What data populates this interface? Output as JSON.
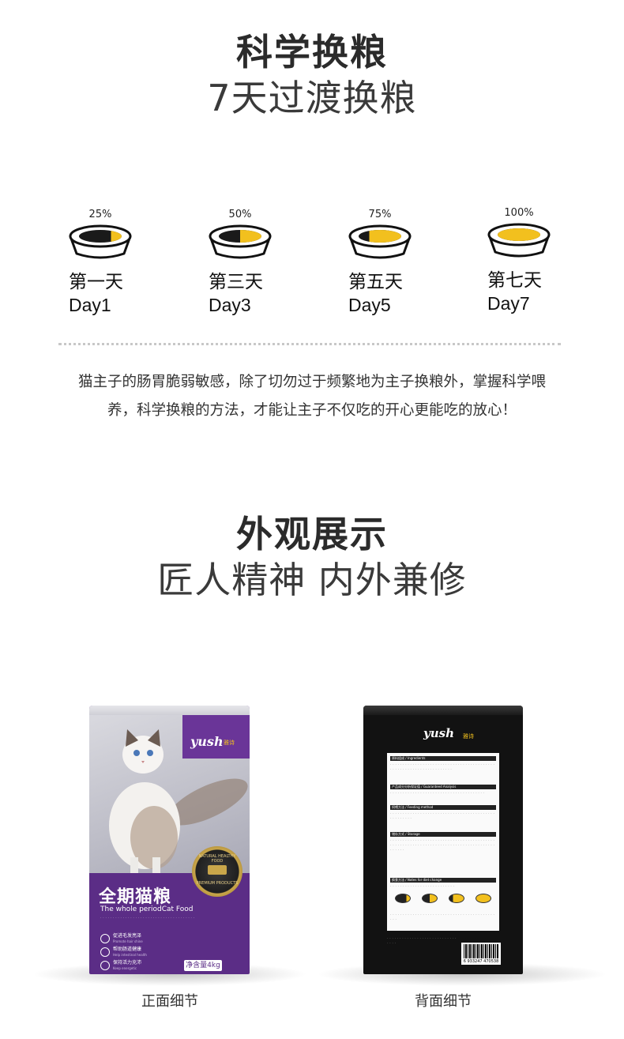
{
  "section1": {
    "title": "科学换粮",
    "subtitle": "7天过渡换粮",
    "steps": [
      {
        "percent": "25%",
        "fill": 0.25,
        "day_cn": "第一天",
        "day_en": "Day1"
      },
      {
        "percent": "50%",
        "fill": 0.5,
        "day_cn": "第三天",
        "day_en": "Day3"
      },
      {
        "percent": "75%",
        "fill": 0.75,
        "day_cn": "第五天",
        "day_en": "Day5"
      },
      {
        "percent": "100%",
        "fill": 1.0,
        "day_cn": "第七天",
        "day_en": "Day7"
      }
    ],
    "paragraph_line1": "猫主子的肠胃脆弱敏感，除了切勿过于频繁地为主子换粮外，掌握科学喂",
    "paragraph_line2": "养，科学换粮的方法，才能让主子不仅吃的开心更能吃的放心！"
  },
  "section2": {
    "title": "外观展示",
    "subtitle": "匠人精神 内外兼修"
  },
  "front_package": {
    "brand": "yush",
    "brand_cn": "雅诗",
    "product_name": "全期猫粮",
    "product_name_en": "The whole periodCat Food",
    "seal_top": "NATURAL HEALTHY FOOD",
    "seal_bottom": "PREMIUM PRODUCTS",
    "features": [
      "促进毛发亮泽",
      "帮助肠道健康",
      "保持活力充沛"
    ],
    "features_en": [
      "Promote hair shine",
      "Help intestinal health",
      "Keep energetic"
    ],
    "net_weight": "净含量4kg",
    "caption": "正面细节"
  },
  "back_package": {
    "brand": "yush",
    "brand_cn": "雅诗",
    "sections": [
      "原料组成 / Ingredients",
      "产品成分分析保证值 / Guaranteed Analysis",
      "饲喂方法 / Feeding method",
      "储存方式 / Storage",
      "换食方法 / Notes for diet change"
    ],
    "barcode_number": "6 933247 470538",
    "caption": "背面细节"
  },
  "colors": {
    "bowl_food": "#f2c01e",
    "bowl_dark": "#1a1a1a",
    "purple": "#5b2d86",
    "purple_dark": "#3f1c63"
  }
}
